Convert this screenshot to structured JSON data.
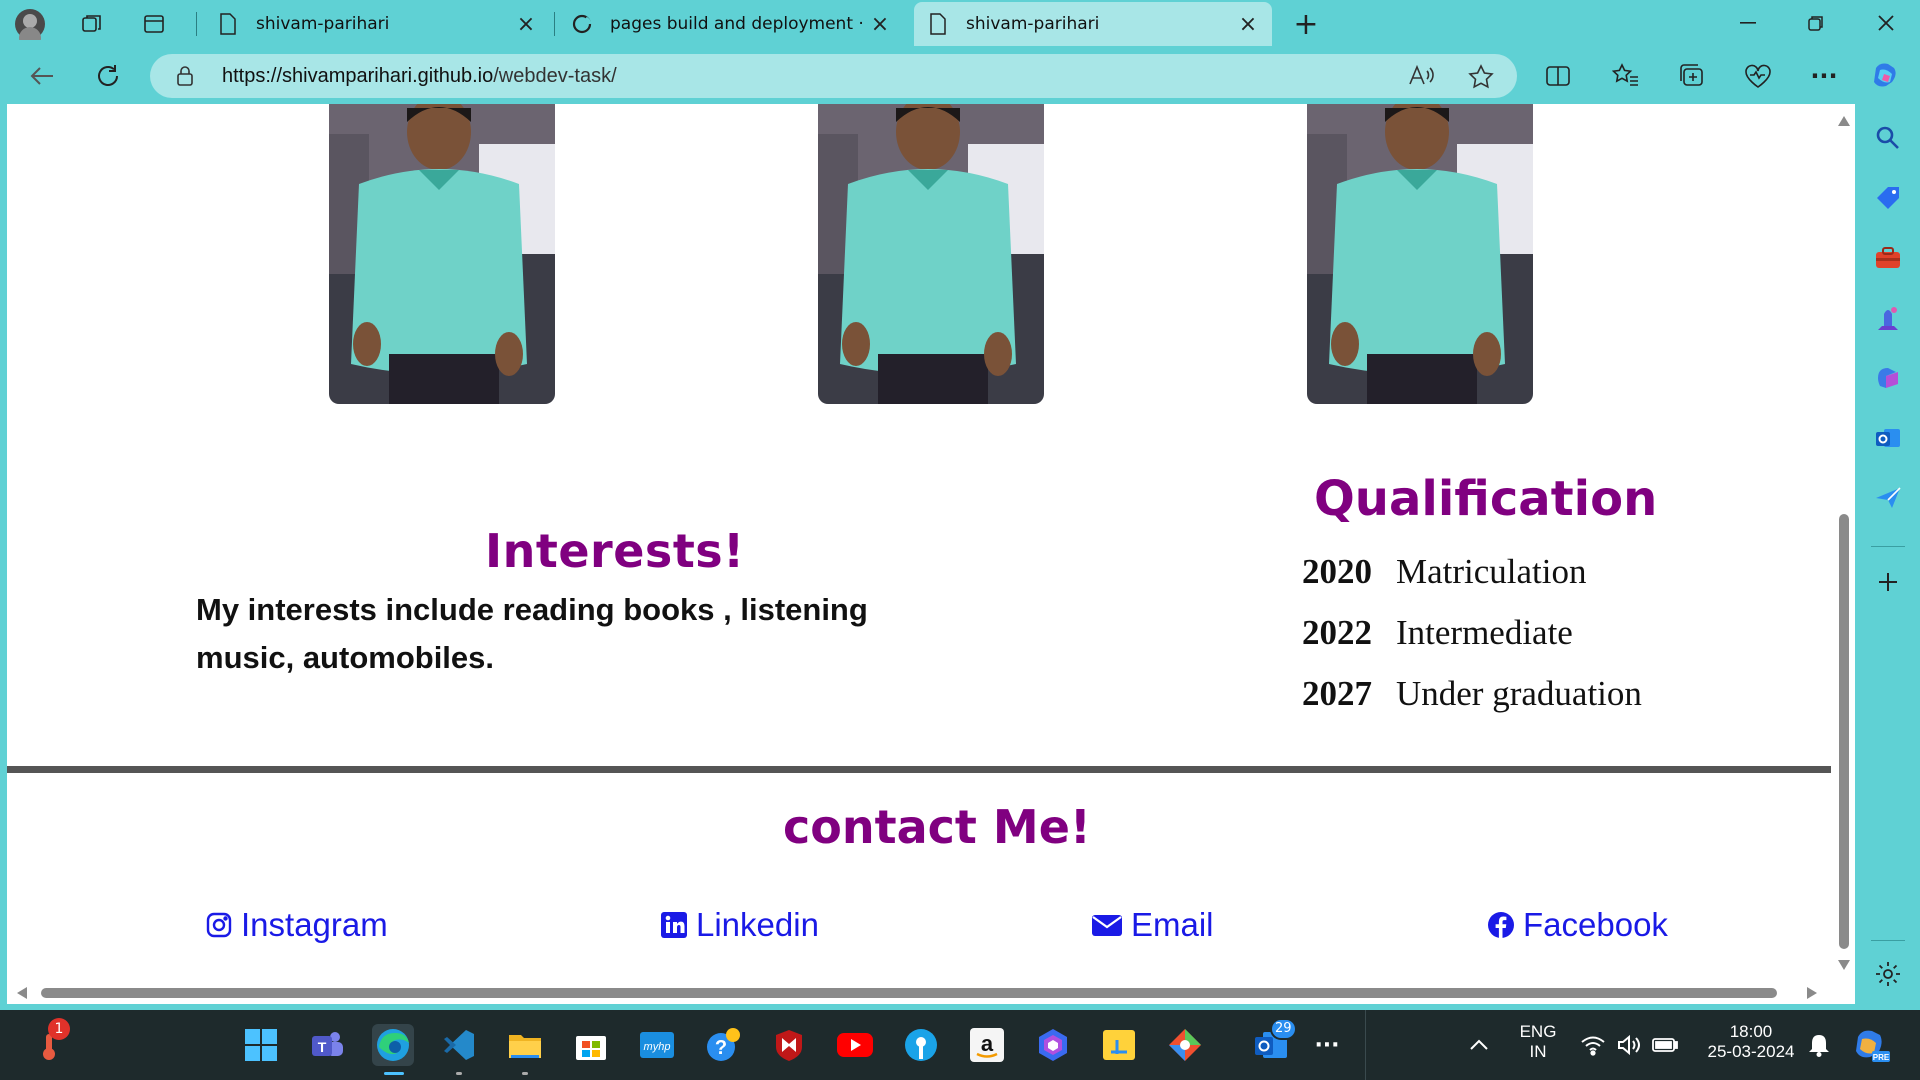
{
  "browser": {
    "tabs": [
      {
        "label": "shivam-parihari",
        "active": false
      },
      {
        "label": "pages build and deployment · sh",
        "active": false
      },
      {
        "label": "shivam-parihari",
        "active": true
      }
    ],
    "url_host": "https://shivamparihari.github.io",
    "url_path": "/webdev-task/"
  },
  "page": {
    "interests": {
      "title": "Interests!",
      "text": "My interests include reading books , listening music, automobiles."
    },
    "qualification": {
      "title": "Qualification",
      "items": [
        {
          "year": "2020",
          "label": "Matriculation"
        },
        {
          "year": "2022",
          "label": "Intermediate"
        },
        {
          "year": "2027",
          "label": "Under graduation"
        }
      ]
    },
    "contact": {
      "title": "contact Me!",
      "links": [
        {
          "label": "Instagram",
          "icon": "instagram-icon"
        },
        {
          "label": "Linkedin",
          "icon": "linkedin-icon"
        },
        {
          "label": "Email",
          "icon": "envelope-icon"
        },
        {
          "label": "Facebook",
          "icon": "facebook-icon"
        }
      ]
    }
  },
  "taskbar": {
    "notification_badge": "1",
    "outlook_badge": "29",
    "lang_1": "ENG",
    "lang_2": "IN",
    "time": "18:00",
    "date": "25-03-2024"
  },
  "colors": {
    "accent": "#5fd1d4",
    "heading": "#800080",
    "link": "#1a1ae6"
  }
}
